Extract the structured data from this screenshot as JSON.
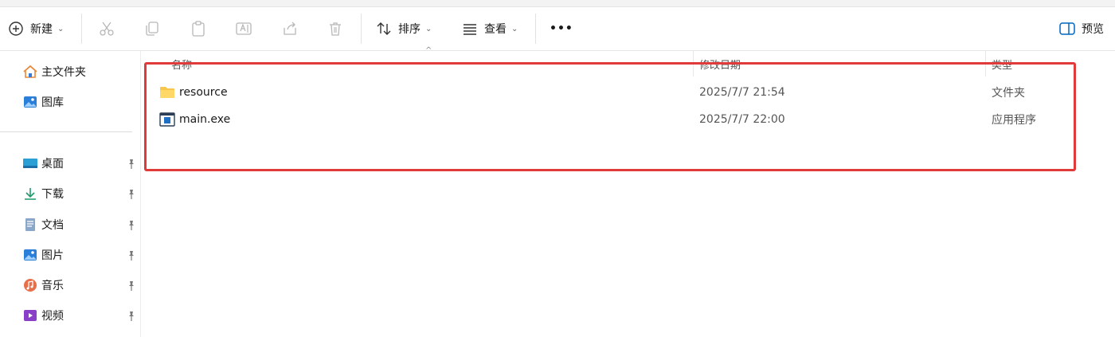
{
  "toolbar": {
    "new_label": "新建",
    "sort_label": "排序",
    "view_label": "查看",
    "more_label": "•••",
    "preview_label": "预览"
  },
  "sidebar": {
    "top_items": [
      {
        "label": "主文件夹",
        "icon": "home-icon"
      },
      {
        "label": "图库",
        "icon": "gallery-icon"
      }
    ],
    "pinned_items": [
      {
        "label": "桌面",
        "icon": "desktop-icon"
      },
      {
        "label": "下载",
        "icon": "download-icon"
      },
      {
        "label": "文档",
        "icon": "document-icon"
      },
      {
        "label": "图片",
        "icon": "pictures-icon"
      },
      {
        "label": "音乐",
        "icon": "music-icon"
      },
      {
        "label": "视频",
        "icon": "video-icon"
      }
    ]
  },
  "file_list": {
    "columns": {
      "name": "名称",
      "modified": "修改日期",
      "type": "类型"
    },
    "rows": [
      {
        "name": "resource",
        "modified": "2025/7/7 21:54",
        "type": "文件夹",
        "icon": "folder-icon"
      },
      {
        "name": "main.exe",
        "modified": "2025/7/7 22:00",
        "type": "应用程序",
        "icon": "exe-icon"
      }
    ]
  },
  "colors": {
    "highlight": "#e03a3a",
    "accent": "#0067c0",
    "folder": "#f7c64a"
  }
}
